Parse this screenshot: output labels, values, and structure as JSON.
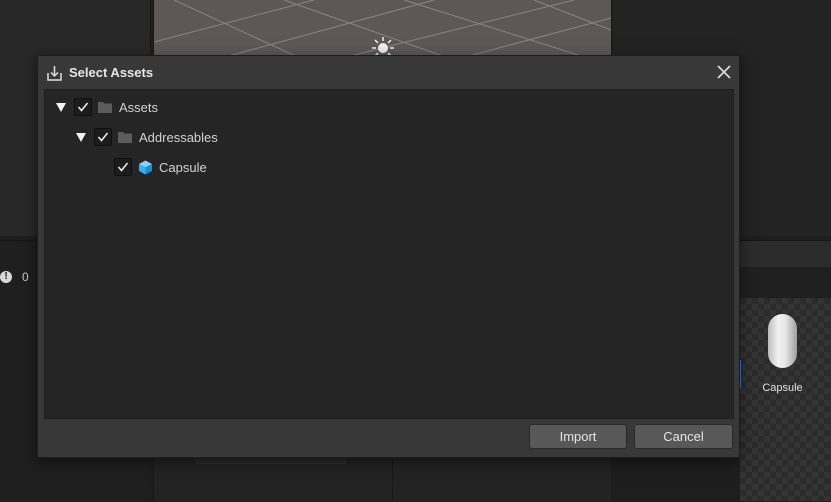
{
  "background": {
    "console_error_count": "0",
    "preview_asset_label": "Capsule"
  },
  "dialog": {
    "title": "Select Assets",
    "title_icon": "download-into-tray-icon",
    "close_icon": "close-icon",
    "tree": [
      {
        "label": "Assets",
        "expanded": true,
        "checked": true,
        "icon": "folder-icon"
      },
      {
        "label": "Addressables",
        "expanded": true,
        "checked": true,
        "icon": "folder-icon"
      },
      {
        "label": "Capsule",
        "checked": true,
        "icon": "prefab-cube-icon"
      }
    ],
    "buttons": {
      "import": "Import",
      "cancel": "Cancel"
    }
  },
  "colors": {
    "dialog_bg": "#383838",
    "tree_bg": "#252525",
    "button_bg": "#585858",
    "prefab_icon": "#2fb3f0"
  }
}
